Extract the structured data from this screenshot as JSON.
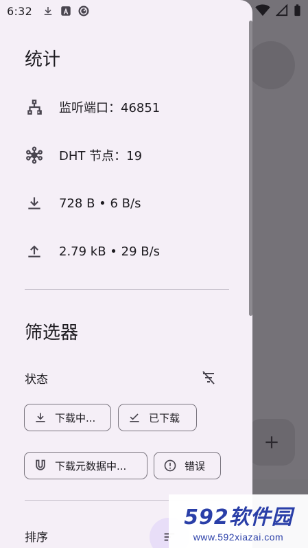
{
  "status_bar": {
    "time": "6:32"
  },
  "drawer": {
    "stats": {
      "title": "统计",
      "rows": [
        {
          "icon": "network-icon",
          "text": "监听端口：46851"
        },
        {
          "icon": "dht-hub-icon",
          "text": "DHT 节点：19"
        },
        {
          "icon": "download-icon",
          "text": "728 B • 6 B/s"
        },
        {
          "icon": "upload-icon",
          "text": "2.79 kB • 29 B/s"
        }
      ]
    },
    "filters": {
      "title": "筛选器",
      "state_label": "状态",
      "chips": [
        {
          "icon": "download-icon",
          "label": "下载中..."
        },
        {
          "icon": "checkmark-icon",
          "label": "已下载"
        },
        {
          "icon": "magnet-icon",
          "label": "下载元数据中..."
        },
        {
          "icon": "error-icon",
          "label": "错误"
        }
      ]
    },
    "sort": {
      "label": "排序"
    }
  },
  "watermark": {
    "logo": "592软件园",
    "url": "www.592xiazai.com"
  },
  "colors": {
    "drawer_bg": "#f5eff7",
    "scrim": "#757278",
    "chip_border": "#79747e",
    "accent_container": "#e8def8",
    "icon": "#49454f"
  }
}
